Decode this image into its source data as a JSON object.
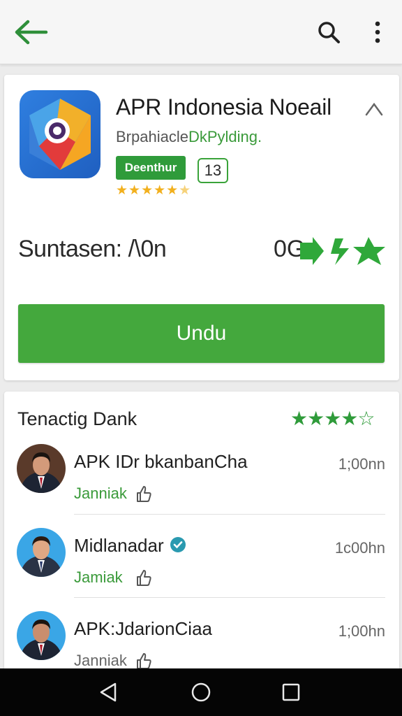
{
  "topbar": {
    "back_icon": "arrow-left-icon",
    "search_icon": "search-icon",
    "menu_icon": "more-vert-icon"
  },
  "app": {
    "title": "APR Indonesia Noeail",
    "developer_a": "Brpahiacle",
    "developer_b": "DkPylding.",
    "badge": "Deenthur",
    "age_rating": "13",
    "rating_stars": "★★★★★",
    "rating_half": "★",
    "size_label": "Suntasen: /\\0n",
    "count_label": "0G",
    "install_label": "Undu",
    "colors": {
      "accent": "#44a83d",
      "badge": "#2f9b3a",
      "star": "#f2b01e"
    }
  },
  "reviews": {
    "title": "Tenactig Dank",
    "stars_full": "★★★★",
    "stars_empty": "☆",
    "items": [
      {
        "name": "APK IDr bkanbanCha",
        "time": "1;00nn",
        "sub": "Janniak"
      },
      {
        "name": "Midlanadar",
        "time": "1c00hn",
        "sub": "Jamiak"
      },
      {
        "name": "APK:JdarionCiaa",
        "time": "1;00hn",
        "sub": "Janniak"
      }
    ]
  },
  "navbar": {
    "back_icon": "nav-back-icon",
    "home_icon": "nav-home-icon",
    "recent_icon": "nav-recents-icon"
  }
}
